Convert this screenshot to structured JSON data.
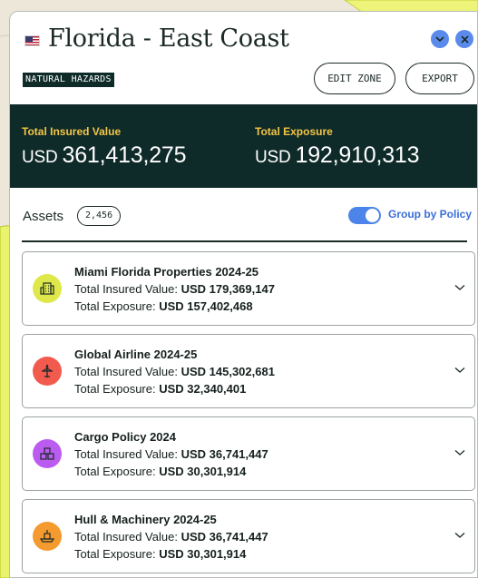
{
  "header": {
    "title": "Florida - East Coast",
    "tag": "NATURAL HAZARDS",
    "edit_zone_label": "EDIT ZONE",
    "export_label": "EXPORT"
  },
  "totals": {
    "insured_label": "Total Insured Value",
    "insured_currency": "USD",
    "insured_amount": "361,413,275",
    "exposure_label": "Total Exposure",
    "exposure_currency": "USD",
    "exposure_amount": "192,910,313"
  },
  "assets": {
    "label": "Assets",
    "count": "2,456",
    "toggle_label": "Group by Policy",
    "toggle_on": true
  },
  "field_labels": {
    "insured": "Total Insured Value:",
    "exposure": "Total Exposure:"
  },
  "policies": [
    {
      "name": "Miami Florida Properties 2024-25",
      "insured": "USD 179,369,147",
      "exposure": "USD 157,402,468",
      "icon": "building-icon",
      "color": "#dfe84a"
    },
    {
      "name": "Global Airline 2024-25",
      "insured": "USD 145,302,681",
      "exposure": "USD 32,340,401",
      "icon": "airplane-icon",
      "color": "#f25a4e"
    },
    {
      "name": "Cargo Policy 2024",
      "insured": "USD 36,741,447",
      "exposure": "USD 30,301,914",
      "icon": "cargo-boxes-icon",
      "color": "#bb5cf0"
    },
    {
      "name": "Hull & Machinery 2024-25",
      "insured": "USD 36,741,447",
      "exposure": "USD 30,301,914",
      "icon": "ship-icon",
      "color": "#f59a2e"
    }
  ],
  "colors": {
    "dark_teal": "#0f2b29",
    "accent_yellow": "#f3c546",
    "accent_blue": "#4d84ea",
    "map_highlight": "#e7f25a"
  }
}
